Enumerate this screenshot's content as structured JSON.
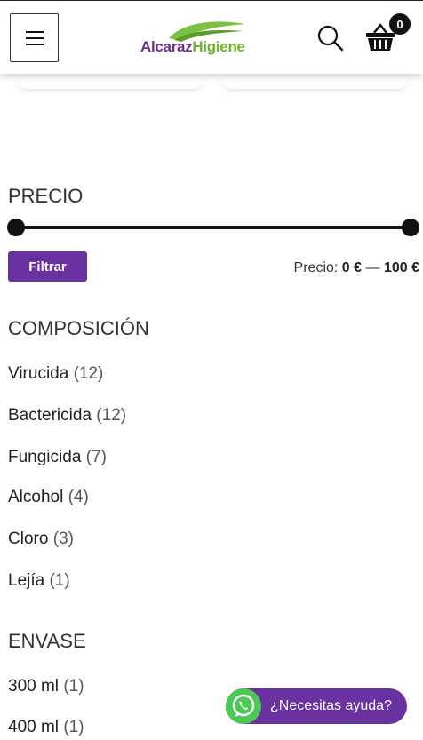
{
  "header": {
    "logo_text_part1": "Alcaraz",
    "logo_text_part2": "Higiene",
    "cart_count": "0",
    "icons": [
      "menu-icon",
      "search-icon",
      "basket-icon"
    ]
  },
  "price_filter": {
    "title": "PRECIO",
    "button_label": "Filtrar",
    "price_prefix": "Precio:",
    "min_price": "0 €",
    "separator": "—",
    "max_price": "100 €",
    "range_min_fraction": 0,
    "range_max_fraction": 1
  },
  "composition": {
    "title": "COMPOSICIÓN",
    "items": [
      {
        "label": "Virucida",
        "count": "(12)"
      },
      {
        "label": "Bactericida",
        "count": "(12)"
      },
      {
        "label": "Fungicida",
        "count": "(7)"
      },
      {
        "label": "Alcohol",
        "count": "(4)"
      },
      {
        "label": "Cloro",
        "count": "(3)"
      },
      {
        "label": "Lejía",
        "count": "(1)"
      }
    ]
  },
  "packaging": {
    "title": "ENVASE",
    "items": [
      {
        "label": "300 ml",
        "count": "(1)"
      },
      {
        "label": "400 ml",
        "count": "(1)"
      }
    ]
  },
  "whatsapp": {
    "label": "¿Necesitas ayuda?",
    "icon": "whatsapp-icon"
  },
  "colors": {
    "accent_purple": "#6a31a0",
    "brand_green": "#6fb32e",
    "whatsapp_green": "#4cc955"
  }
}
